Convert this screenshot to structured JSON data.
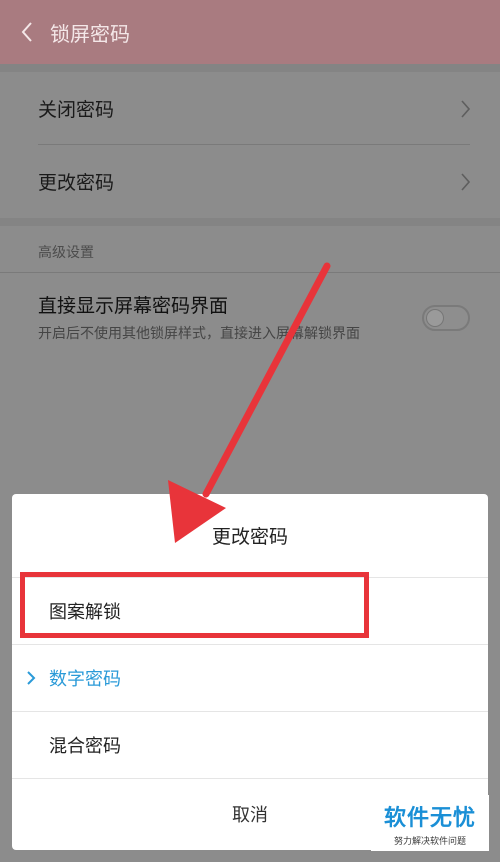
{
  "header": {
    "title": "锁屏密码",
    "back_icon": "chevron-left-icon"
  },
  "settings": {
    "items": [
      {
        "label": "关闭密码"
      },
      {
        "label": "更改密码"
      }
    ],
    "section_title": "高级设置",
    "direct_show": {
      "title": "直接显示屏幕密码界面",
      "subtitle": "开启后不使用其他锁屏样式，直接进入屏幕解锁界面",
      "enabled": false
    }
  },
  "dialog": {
    "title": "更改密码",
    "options": [
      {
        "label": "图案解锁",
        "selected": false
      },
      {
        "label": "数字密码",
        "selected": true
      },
      {
        "label": "混合密码",
        "selected": false
      }
    ],
    "cancel_label": "取消"
  },
  "colors": {
    "accent": "#2a9ad8",
    "annotation": "#e8343a",
    "header": "#a97b80"
  },
  "watermark": {
    "main": "软件无忧",
    "sub": "努力解决软件问题"
  }
}
